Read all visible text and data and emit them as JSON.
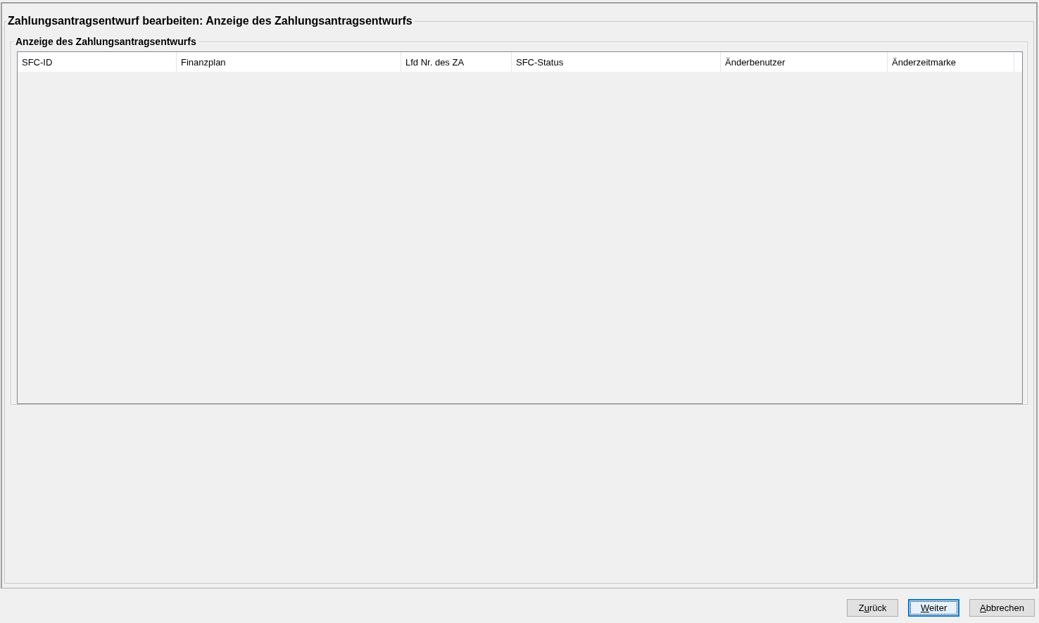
{
  "panel": {
    "title": "Zahlungsantragsentwurf bearbeiten: Anzeige des Zahlungsantragsentwurfs"
  },
  "group": {
    "title": "Anzeige des Zahlungsantragsentwurfs"
  },
  "table": {
    "columns": [
      {
        "label": "SFC-ID"
      },
      {
        "label": "Finanzplan"
      },
      {
        "label": "Lfd Nr. des ZA"
      },
      {
        "label": "SFC-Status"
      },
      {
        "label": "Änderbenutzer"
      },
      {
        "label": "Änderzeitmarke"
      }
    ]
  },
  "buttons": [
    {
      "before": "Z",
      "mnemonic": "u",
      "after": "rück",
      "focused": false
    },
    {
      "mnemonic": "W",
      "after": "eiter",
      "focused": true
    },
    {
      "mnemonic": "A",
      "after": "bbrechen",
      "focused": false
    }
  ]
}
